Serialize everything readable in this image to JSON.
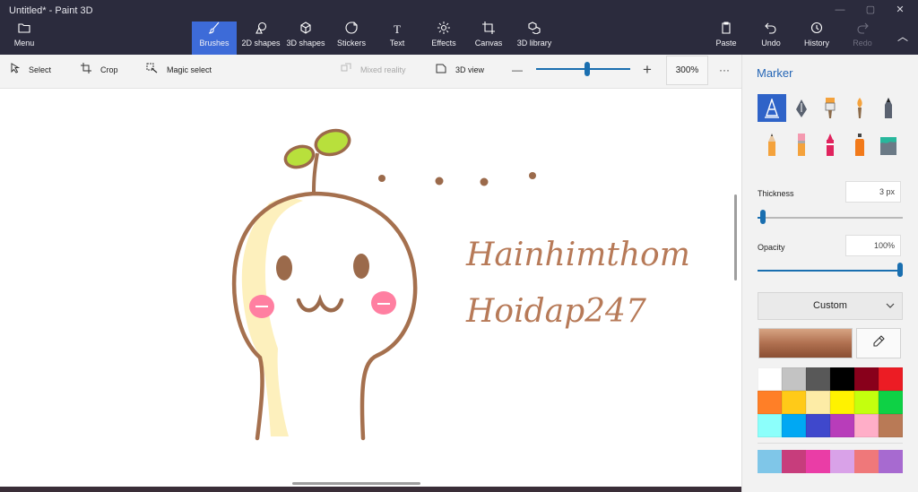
{
  "window": {
    "title": "Untitled* - Paint 3D",
    "controls": [
      {
        "name": "minimize",
        "glyph": "—"
      },
      {
        "name": "maximize",
        "glyph": "▢"
      },
      {
        "name": "close",
        "glyph": "✕"
      }
    ]
  },
  "ribbon": {
    "menu": {
      "label": "Menu",
      "icon": "folder-icon"
    },
    "tools": [
      {
        "label": "Brushes",
        "icon": "brush-icon",
        "active": true
      },
      {
        "label": "2D shapes",
        "icon": "2d-shapes-icon"
      },
      {
        "label": "3D shapes",
        "icon": "3d-shapes-icon"
      },
      {
        "label": "Stickers",
        "icon": "stickers-icon"
      },
      {
        "label": "Text",
        "icon": "text-icon"
      },
      {
        "label": "Effects",
        "icon": "effects-icon"
      },
      {
        "label": "Canvas",
        "icon": "canvas-icon"
      },
      {
        "label": "3D library",
        "icon": "3d-library-icon"
      }
    ],
    "right": [
      {
        "label": "Paste",
        "icon": "paste-icon"
      },
      {
        "label": "Undo",
        "icon": "undo-icon"
      },
      {
        "label": "History",
        "icon": "history-icon"
      },
      {
        "label": "Redo",
        "icon": "redo-icon",
        "disabled": true
      }
    ],
    "collapse_glyph": "︿"
  },
  "toolbar": {
    "select": "Select",
    "crop": "Crop",
    "magic_select": "Magic select",
    "mixed_reality": "Mixed reality",
    "view_3d": "3D view",
    "zoom_minus": "—",
    "zoom_plus": "+",
    "zoom_value": "300%",
    "zoom_level": 0.55,
    "more": "···"
  },
  "canvas": {
    "text_line1": "Hainhimthom",
    "text_line2": "Hoidap247",
    "ink_color": "#b77a58"
  },
  "panel": {
    "title": "Marker",
    "brushes": [
      {
        "name": "marker-icon",
        "selected": true
      },
      {
        "name": "calligraphy-pen-icon"
      },
      {
        "name": "oil-brush-icon"
      },
      {
        "name": "watercolor-icon"
      },
      {
        "name": "pixel-pen-icon"
      },
      {
        "name": "pencil-icon"
      },
      {
        "name": "eraser-icon"
      },
      {
        "name": "crayon-icon"
      },
      {
        "name": "spray-can-icon"
      },
      {
        "name": "fill-bucket-icon"
      }
    ],
    "thickness_label": "Thickness",
    "thickness_value": "3 px",
    "thickness_level": 0.02,
    "opacity_label": "Opacity",
    "opacity_value": "100%",
    "opacity_level": 1.0,
    "color_mode": "Custom",
    "current_color": "#b07050",
    "palette": [
      "#ffffff",
      "#c3c3c3",
      "#585858",
      "#000000",
      "#88001b",
      "#ec1c24",
      "#ff7f27",
      "#ffca18",
      "#fdeca6",
      "#fff200",
      "#c4ff0e",
      "#0ed145",
      "#8cfffb",
      "#00a8f3",
      "#3f48cc",
      "#b83dba",
      "#ffaec8",
      "#b97a56"
    ],
    "custom_palette": [
      "#7fc6e8",
      "#c73d7c",
      "#ea3da6",
      "#d9a2e8",
      "#ef787a",
      "#a76ad0"
    ]
  }
}
